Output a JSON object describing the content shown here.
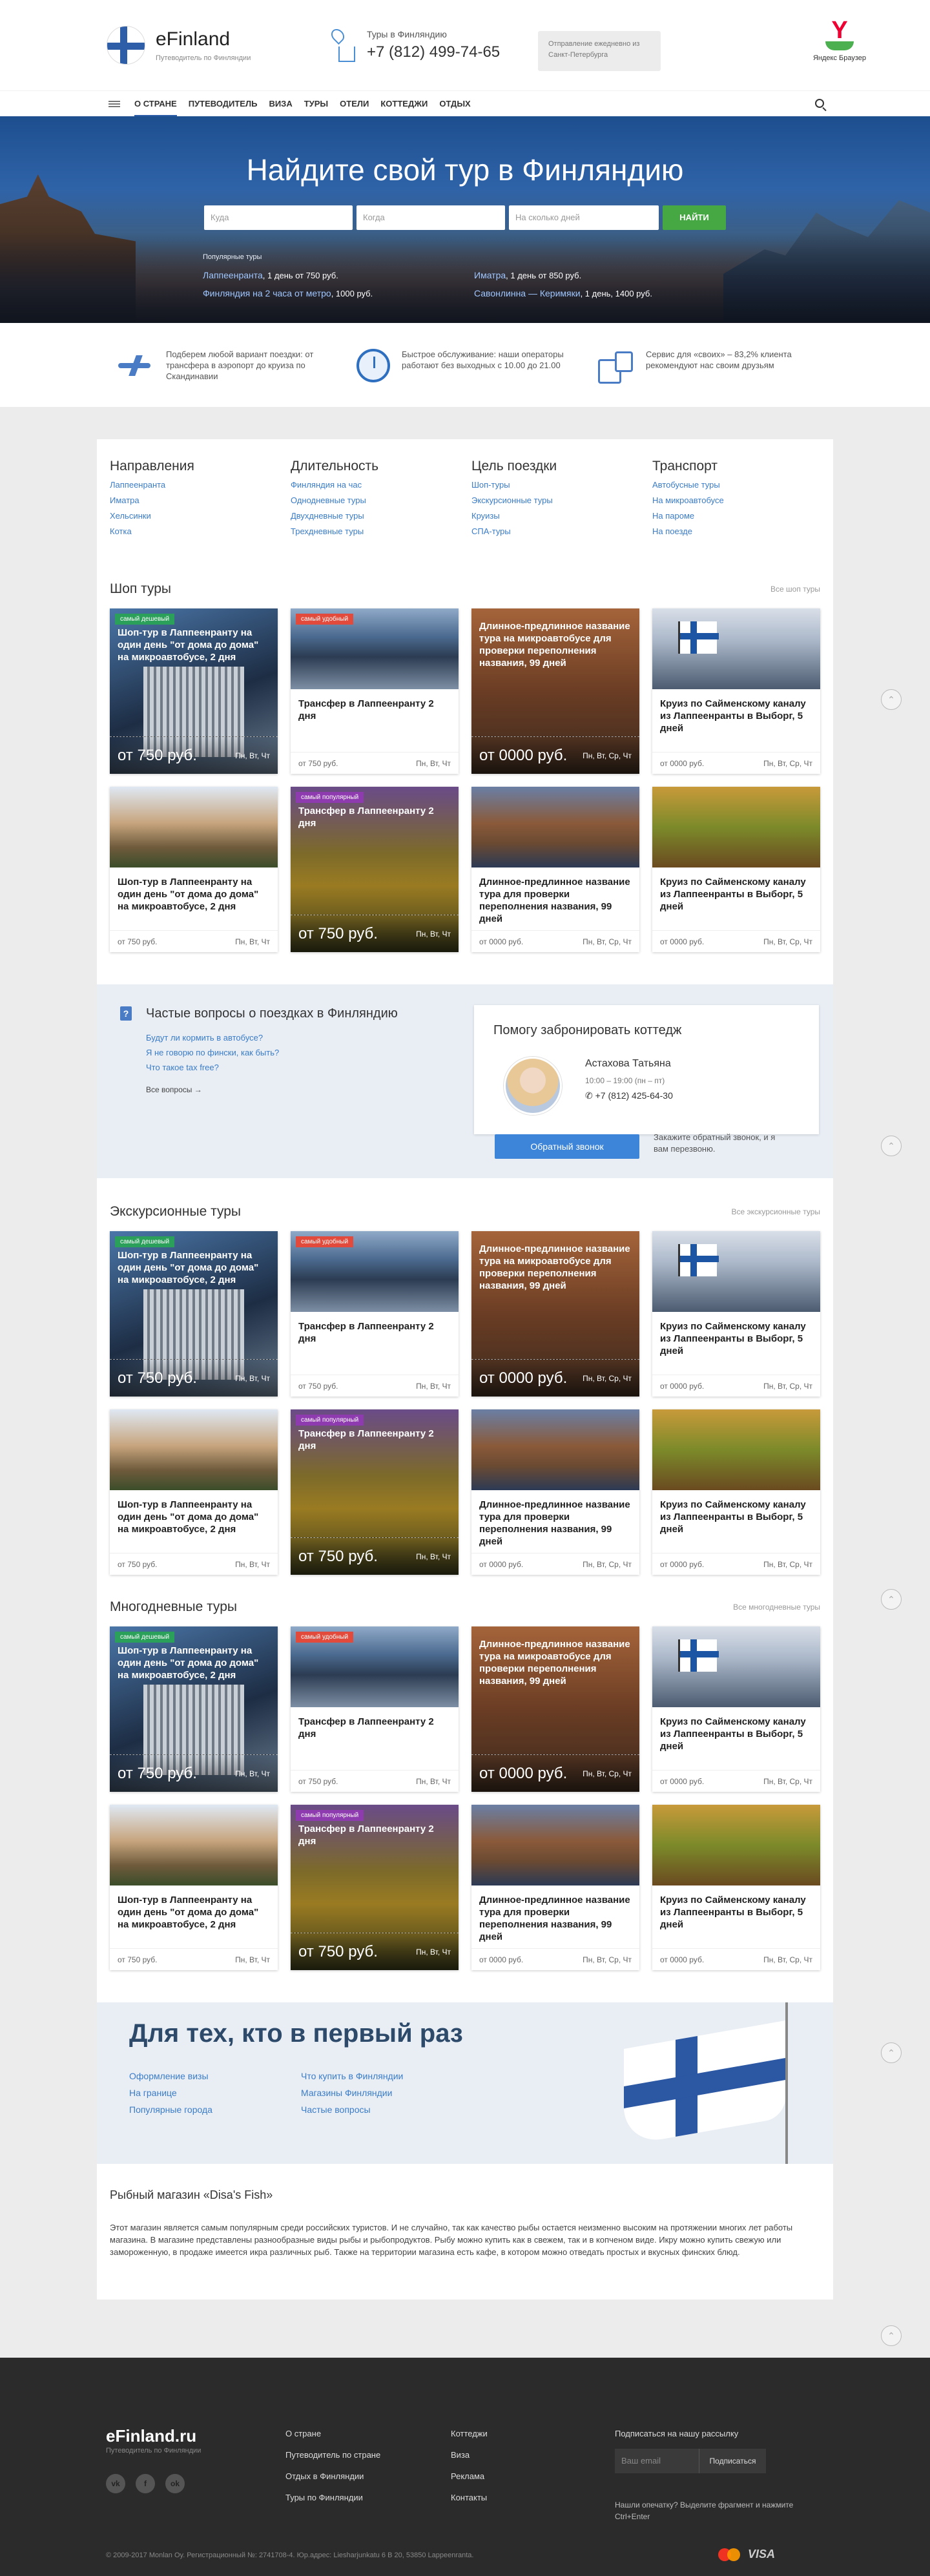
{
  "header": {
    "brand": "eFinland",
    "brand_sub": "Путеводитель по Финляндии",
    "phone_label": "Туры в Финляндию",
    "phone": "+7 (812) 499-74-65",
    "departure": "Отправление ежедневно из Санкт-Петербурга",
    "browser": "Яндекс Браузер"
  },
  "nav": {
    "items": [
      "О стране",
      "Путеводитель",
      "Виза",
      "Туры",
      "Отели",
      "Коттеджи",
      "Отдых"
    ],
    "active": "О стране"
  },
  "hero": {
    "title": "Найдите свой тур в Финляндию",
    "where_placeholder": "Куда",
    "when_placeholder": "Когда",
    "days_placeholder": "На сколько дней",
    "search_button": "Найти",
    "popular_label": "Популярные туры",
    "popular": [
      {
        "name": "Лаппеенранта",
        "info": ", 1 день от 750 руб."
      },
      {
        "name": "Иматра",
        "info": ", 1 день от 850 руб."
      },
      {
        "name": "Финляндия на 2 часа от метро",
        "info": ", 1000 руб."
      },
      {
        "name": "Савонлинна — Керимяки",
        "info": ", 1 день, 1400 руб."
      }
    ]
  },
  "features": [
    "Подберем любой вариант поездки: от трансфера в аэропорт до круиза по Скандинавии",
    "Быстрое обслуживание: наши операторы работают без выходных с 10.00 до 21.00",
    "Сервис для «своих» – 83,2% клиента рекомендуют нас своим друзьям"
  ],
  "filters": [
    {
      "title": "Направления",
      "links": [
        "Лаппеенранта",
        "Иматра",
        "Хельсинки",
        "Котка"
      ]
    },
    {
      "title": "Длительность",
      "links": [
        "Финляндия на час",
        "Однодневные туры",
        "Двухдневные туры",
        "Трехдневные туры"
      ]
    },
    {
      "title": "Цель поездки",
      "links": [
        "Шоп-туры",
        "Экскурсионные туры",
        "Круизы",
        "СПА-туры"
      ]
    },
    {
      "title": "Транспорт",
      "links": [
        "Автобусные туры",
        "На микроавтобусе",
        "На пароме",
        "На поезде"
      ]
    }
  ],
  "sections": [
    {
      "title": "Шоп туры",
      "all": "Все шоп туры"
    },
    {
      "title": "Экскурсионные туры",
      "all": "Все экскурсионные туры"
    },
    {
      "title": "Многодневные туры",
      "all": "Все многодневные туры"
    }
  ],
  "cards": [
    {
      "badge": "самый дешевый",
      "title": "Шоп-тур в Лаппеенранту на один день \"от дома до дома\" на микроавтобусе, 2 дня",
      "price": "от 750 руб.",
      "days": "Пн, Вт, Чт"
    },
    {
      "badge": "самый удобный",
      "title": "Трансфер в Лаппеенранту 2 дня",
      "price": "от 750 руб.",
      "days": "Пн, Вт, Чт"
    },
    {
      "badge": "",
      "title": "Длинное-предлинное название тура на микроавтобусе для проверки переполнения названия, 99 дней",
      "price": "от 0000 руб.",
      "days": "Пн, Вт, Ср, Чт"
    },
    {
      "badge": "",
      "title": "Круиз по Сайменскому каналу из Лаппеенранты в Выборг, 5 дней",
      "price": "от 0000 руб.",
      "days": "Пн, Вт, Ср, Чт"
    },
    {
      "badge": "",
      "title": "Шоп-тур в Лаппеенранту на один день \"от дома до дома\" на микроавтобусе, 2 дня",
      "price": "от 750 руб.",
      "days": "Пн, Вт, Чт"
    },
    {
      "badge": "самый популярный",
      "title": "Трансфер в Лаппеенранту 2 дня",
      "price": "от 750 руб.",
      "days": "Пн, Вт, Чт"
    },
    {
      "badge": "",
      "title": "Длинное-предлинное название тура для проверки переполнения названия, 99 дней",
      "price": "от 0000 руб.",
      "days": "Пн, Вт, Ср, Чт"
    },
    {
      "badge": "",
      "title": "Круиз по Сайменскому каналу из Лаппеенранты в Выборг, 5 дней",
      "price": "от 0000 руб.",
      "days": "Пн, Вт, Ср, Чт"
    }
  ],
  "faq": {
    "title": "Частые вопросы о поездках в Финляндию",
    "questions": [
      "Будут ли кормить в автобусе?",
      "Я не говорю по фински, как быть?",
      "Что такое tax free?"
    ],
    "all": "Все вопросы →"
  },
  "help": {
    "title": "Помогу забронировать коттедж",
    "name": "Астахова Татьяна",
    "hours": "10:00 – 19:00 (пн – пт)",
    "phone": "+7 (812) 425-64-30",
    "button": "Обратный звонок",
    "note": "Закажите обратный звонок, и я вам перезвоню."
  },
  "first_time": {
    "title": "Для тех, кто в первый раз",
    "col1": [
      "Оформление визы",
      "На границе",
      "Популярные города"
    ],
    "col2": [
      "Что купить в Финляндии",
      "Магазины Финляндии",
      "Частые вопросы"
    ]
  },
  "shop": {
    "title": "Рыбный магазин «Disa's Fish»",
    "text": "Этот магазин является самым популярным среди российских туристов. И не случайно, так как качество рыбы остается неизменно высоким на протяжении многих лет работы магазина. В магазине представлены разнообразные виды рыбы и рыбопродуктов. Рыбу можно купить как в свежем, так и в копченом виде. Икру можно купить свежую или замороженную, в продаже имеется икра различных рыб. Также на территории магазина есть кафе, в котором можно отведать простых и вкусных финских блюд."
  },
  "footer": {
    "brand": "eFinland.ru",
    "brand_sub": "Путеводитель по Финляндии",
    "social": [
      "vk",
      "f",
      "ok"
    ],
    "col1": [
      "О стране",
      "Путеводитель по стране",
      "Отдых в Финляндии",
      "Туры по Финляндии"
    ],
    "col2": [
      "Коттеджи",
      "Виза",
      "Реклама",
      "Контакты"
    ],
    "subscribe": "Подписаться на нашу рассылку",
    "email_placeholder": "Ваш email",
    "subscribe_button": "Подписаться",
    "typo": "Нашли опечатку? Выделите фрагмент и нажмите Ctrl+Enter",
    "copyright": "© 2009-2017 Monlan Oy. Регистрационный №: 2741708-4. Юр.адрес: Liesharjunkatu 6 B 20, 53850 Lappeenranta.",
    "visa": "VISA"
  }
}
